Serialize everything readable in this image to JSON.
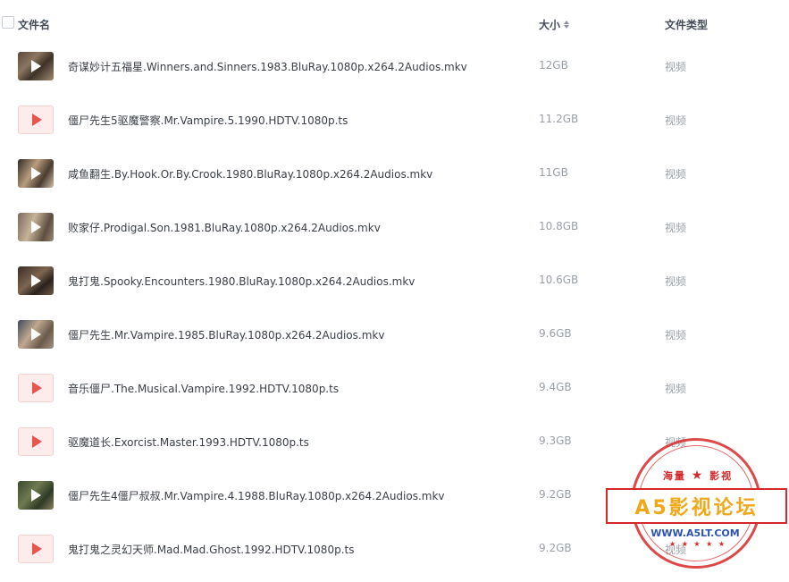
{
  "header": {
    "name_label": "文件名",
    "size_label": "大小",
    "type_label": "文件类型"
  },
  "files": [
    {
      "name": "奇谋妙计五福星.Winners.and.Sinners.1983.BluRay.1080p.x264.2Audios.mkv",
      "size": "12GB",
      "type": "视频",
      "icon": "video-thumbnail"
    },
    {
      "name": "僵尸先生5驱魔警察.Mr.Vampire.5.1990.HDTV.1080p.ts",
      "size": "11.2GB",
      "type": "视频",
      "icon": "ts-file-icon"
    },
    {
      "name": "咸鱼翻生.By.Hook.Or.By.Crook.1980.BluRay.1080p.x264.2Audios.mkv",
      "size": "11GB",
      "type": "视频",
      "icon": "video-thumbnail"
    },
    {
      "name": "败家仔.Prodigal.Son.1981.BluRay.1080p.x264.2Audios.mkv",
      "size": "10.8GB",
      "type": "视频",
      "icon": "video-thumbnail"
    },
    {
      "name": "鬼打鬼.Spooky.Encounters.1980.BluRay.1080p.x264.2Audios.mkv",
      "size": "10.6GB",
      "type": "视频",
      "icon": "video-thumbnail"
    },
    {
      "name": "僵尸先生.Mr.Vampire.1985.BluRay.1080p.x264.2Audios.mkv",
      "size": "9.6GB",
      "type": "视频",
      "icon": "video-thumbnail"
    },
    {
      "name": "音乐僵尸.The.Musical.Vampire.1992.HDTV.1080p.ts",
      "size": "9.4GB",
      "type": "视频",
      "icon": "ts-file-icon"
    },
    {
      "name": "驱魔道长.Exorcist.Master.1993.HDTV.1080p.ts",
      "size": "9.3GB",
      "type": "视频",
      "icon": "ts-file-icon"
    },
    {
      "name": "僵尸先生4僵尸叔叔.Mr.Vampire.4.1988.BluRay.1080p.x264.2Audios.mkv",
      "size": "9.2GB",
      "type": "视频",
      "icon": "video-thumbnail"
    },
    {
      "name": "鬼打鬼之灵幻天师.Mad.Mad.Ghost.1992.HDTV.1080p.ts",
      "size": "9.2GB",
      "type": "视频",
      "icon": "ts-file-icon"
    }
  ],
  "watermark": {
    "top_text": "海量",
    "top_text_2": "影视",
    "band_text": "A5影视论坛",
    "url": "WWW.A5LT.COM"
  },
  "colors": {
    "ts_icon_accent": "#e8554a",
    "watermark_red": "#d62828",
    "watermark_gold": "#f0a818",
    "watermark_blue": "#2b52b8"
  }
}
